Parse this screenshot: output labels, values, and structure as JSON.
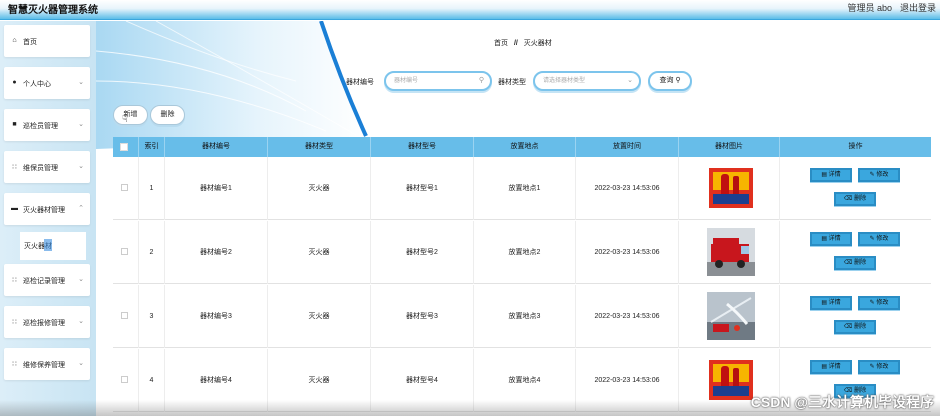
{
  "app": {
    "title": "智慧灭火器管理系统",
    "user": "管理员 abo",
    "logout": "退出登录"
  },
  "sidebar": {
    "items": [
      {
        "icon": "home-icon",
        "label": "首页",
        "arrow": false
      },
      {
        "icon": "person-icon",
        "label": "个人中心",
        "arrow": true
      },
      {
        "icon": "briefcase-icon",
        "label": "巡检员管理",
        "arrow": true
      },
      {
        "icon": "grid-icon",
        "label": "维保员管理",
        "arrow": true
      },
      {
        "icon": "folder-icon",
        "label": "灭火器材管理",
        "arrow": true
      },
      {
        "icon": "grid-icon",
        "label": "巡检记录管理",
        "arrow": true
      },
      {
        "icon": "grid-icon",
        "label": "巡检报修管理",
        "arrow": true
      },
      {
        "icon": "grid-icon",
        "label": "维修保养管理",
        "arrow": true
      }
    ],
    "submenu_label": "灭火器材"
  },
  "breadcrumb": {
    "home": "首页",
    "sep": "//",
    "current": "灭火器材"
  },
  "search": {
    "code_label": "器材编号",
    "code_placeholder": "器材编号",
    "type_label": "器材类型",
    "type_placeholder": "请选择器材类型",
    "query_label": "查询"
  },
  "toolbar": {
    "add_label": "新增",
    "delete_label": "删除"
  },
  "table": {
    "headers": [
      "索引",
      "器材编号",
      "器材类型",
      "器材型号",
      "放置地点",
      "放置时间",
      "器材图片",
      "操作"
    ],
    "rows": [
      {
        "index": "1",
        "code": "器材编号1",
        "type": "灭火器",
        "model": "器材型号1",
        "location": "放置地点1",
        "time": "2022-03-23 14:53:06",
        "image": "fire-extinguisher-box"
      },
      {
        "index": "2",
        "code": "器材编号2",
        "type": "灭火器",
        "model": "器材型号2",
        "location": "放置地点2",
        "time": "2022-03-23 14:53:06",
        "image": "fire-truck"
      },
      {
        "index": "3",
        "code": "器材编号3",
        "type": "灭火器",
        "model": "器材型号3",
        "location": "放置地点3",
        "time": "2022-03-23 14:53:06",
        "image": "fire-fighting-scene"
      },
      {
        "index": "4",
        "code": "器材编号4",
        "type": "灭火器",
        "model": "器材型号4",
        "location": "放置地点4",
        "time": "2022-03-23 14:53:06",
        "image": "fire-extinguisher-box"
      }
    ],
    "actions": {
      "detail": "详情",
      "edit": "修改",
      "delete": "删除"
    }
  },
  "watermark": "CSDN @三水计算机毕设程序",
  "colors": {
    "accent": "#3aa7de",
    "header_bg": "#67bde9",
    "sidebar_bg": "#d3eaf6"
  }
}
